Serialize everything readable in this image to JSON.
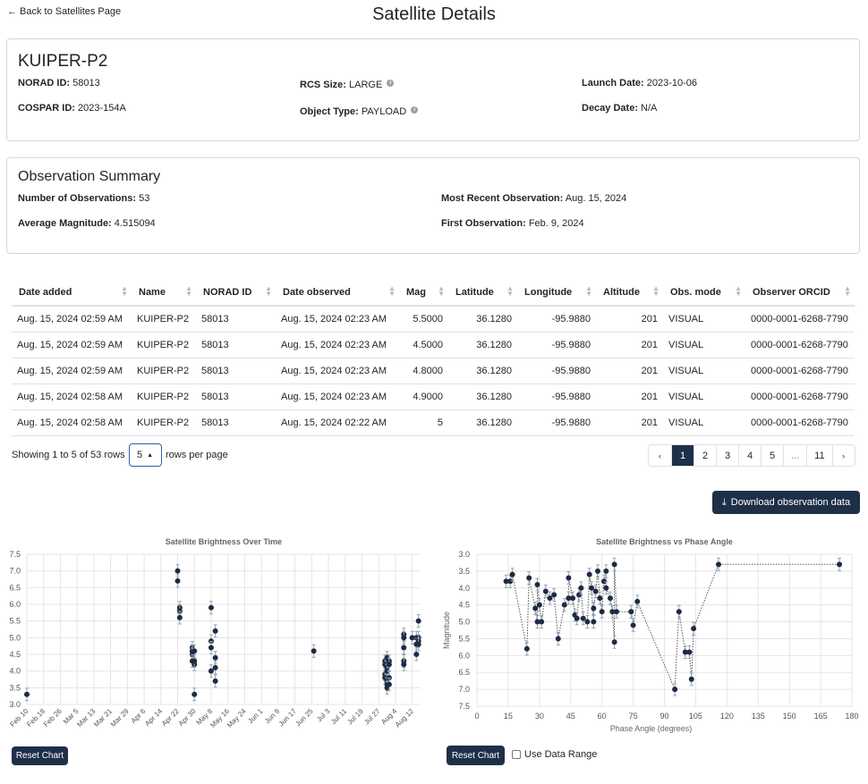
{
  "nav": {
    "back_label": "Back to Satellites Page"
  },
  "page_title": "Satellite Details",
  "satellite": {
    "name": "KUIPER-P2",
    "fields": [
      {
        "label": "NORAD ID:",
        "value": "58013"
      },
      {
        "label": "COSPAR ID:",
        "value": "2023-154A"
      },
      {
        "label": "RCS Size:",
        "value": "LARGE"
      },
      {
        "label": "Object Type:",
        "value": "PAYLOAD"
      },
      {
        "label": "Launch Date:",
        "value": "2023-10-06"
      },
      {
        "label": "Decay Date:",
        "value": "N/A"
      }
    ]
  },
  "summary": {
    "title": "Observation Summary",
    "fields": [
      {
        "label": "Number of Observations:",
        "value": "53"
      },
      {
        "label": "Average Magnitude:",
        "value": "4.515094"
      },
      {
        "label": "Most Recent Observation:",
        "value": "Aug. 15, 2024"
      },
      {
        "label": "First Observation:",
        "value": "Feb. 9, 2024"
      }
    ]
  },
  "table": {
    "columns": [
      "Date added",
      "Name",
      "NORAD ID",
      "Date observed",
      "Mag",
      "Latitude",
      "Longitude",
      "Altitude",
      "Obs. mode",
      "Observer ORCID"
    ],
    "rows": [
      [
        "Aug. 15, 2024 02:59 AM",
        "KUIPER-P2",
        "58013",
        "Aug. 15, 2024 02:23 AM",
        "5.5000",
        "36.1280",
        "-95.9880",
        "201",
        "VISUAL",
        "0000-0001-6268-7790"
      ],
      [
        "Aug. 15, 2024 02:59 AM",
        "KUIPER-P2",
        "58013",
        "Aug. 15, 2024 02:23 AM",
        "4.5000",
        "36.1280",
        "-95.9880",
        "201",
        "VISUAL",
        "0000-0001-6268-7790"
      ],
      [
        "Aug. 15, 2024 02:59 AM",
        "KUIPER-P2",
        "58013",
        "Aug. 15, 2024 02:23 AM",
        "4.8000",
        "36.1280",
        "-95.9880",
        "201",
        "VISUAL",
        "0000-0001-6268-7790"
      ],
      [
        "Aug. 15, 2024 02:58 AM",
        "KUIPER-P2",
        "58013",
        "Aug. 15, 2024 02:23 AM",
        "4.9000",
        "36.1280",
        "-95.9880",
        "201",
        "VISUAL",
        "0000-0001-6268-7790"
      ],
      [
        "Aug. 15, 2024 02:58 AM",
        "KUIPER-P2",
        "58013",
        "Aug. 15, 2024 02:22 AM",
        "5",
        "36.1280",
        "-95.9880",
        "201",
        "VISUAL",
        "0000-0001-6268-7790"
      ]
    ]
  },
  "pager": {
    "showing": "Showing 1 to 5 of 53 rows",
    "rows_per_page_value": "5",
    "rows_per_page_label": "rows per page",
    "prev": "‹",
    "next": "›",
    "pages": [
      "1",
      "2",
      "3",
      "4",
      "5",
      "...",
      "11"
    ],
    "active_page": "1"
  },
  "buttons": {
    "download": "Download observation data",
    "reset_chart": "Reset Chart",
    "use_data_range": "Use Data Range"
  },
  "icons": {
    "back": "arrow-left-icon",
    "info": "info-circle-icon",
    "sort": "sort-icon",
    "download": "download-icon",
    "caret": "caret-up-icon"
  },
  "colors": {
    "accent": "#1e2f48",
    "point": "#1c2b45",
    "grid": "#e5e5e5",
    "select_border": "#2c5ea8"
  },
  "chart_data": [
    {
      "type": "scatter",
      "title": "Satellite Brightness Over Time",
      "xlabel": "",
      "ylabel": "",
      "x_tick_labels": [
        "Feb 10",
        "Feb 18",
        "Feb 26",
        "Mar 5",
        "Mar 13",
        "Mar 21",
        "Mar 29",
        "Apr 6",
        "Apr 14",
        "Apr 22",
        "Apr 30",
        "May 8",
        "May 16",
        "May 24",
        "Jun 1",
        "Jun 9",
        "Jun 17",
        "Jun 25",
        "Jul 3",
        "Jul 11",
        "Jul 19",
        "Jul 27",
        "Aug 4",
        "Aug 12"
      ],
      "y_tick_labels": [
        "3.0",
        "3.5",
        "4.0",
        "4.5",
        "5.0",
        "5.5",
        "6.0",
        "6.5",
        "7.0",
        "7.5"
      ],
      "ylim": [
        3.0,
        7.5
      ],
      "xlim": [
        "2024-02-10",
        "2024-08-16"
      ],
      "grid": true,
      "points": [
        {
          "x": "2024-02-10",
          "y": 3.3
        },
        {
          "x": "2024-04-22",
          "y": 7.0
        },
        {
          "x": "2024-04-22",
          "y": 6.7
        },
        {
          "x": "2024-04-23",
          "y": 5.9
        },
        {
          "x": "2024-04-23",
          "y": 5.8
        },
        {
          "x": "2024-04-23",
          "y": 5.6
        },
        {
          "x": "2024-04-29",
          "y": 4.7
        },
        {
          "x": "2024-04-29",
          "y": 4.6
        },
        {
          "x": "2024-04-29",
          "y": 4.5
        },
        {
          "x": "2024-04-29",
          "y": 4.3
        },
        {
          "x": "2024-04-30",
          "y": 4.2
        },
        {
          "x": "2024-04-30",
          "y": 4.3
        },
        {
          "x": "2024-04-30",
          "y": 4.6
        },
        {
          "x": "2024-04-30",
          "y": 3.3
        },
        {
          "x": "2024-05-08",
          "y": 5.9
        },
        {
          "x": "2024-05-08",
          "y": 4.9
        },
        {
          "x": "2024-05-08",
          "y": 4.7
        },
        {
          "x": "2024-05-08",
          "y": 4.0
        },
        {
          "x": "2024-05-10",
          "y": 5.2
        },
        {
          "x": "2024-05-10",
          "y": 4.4
        },
        {
          "x": "2024-05-10",
          "y": 4.1
        },
        {
          "x": "2024-05-10",
          "y": 3.7
        },
        {
          "x": "2024-06-26",
          "y": 4.6
        },
        {
          "x": "2024-07-30",
          "y": 4.3
        },
        {
          "x": "2024-07-30",
          "y": 4.2
        },
        {
          "x": "2024-07-30",
          "y": 3.9
        },
        {
          "x": "2024-07-30",
          "y": 3.8
        },
        {
          "x": "2024-07-31",
          "y": 4.4
        },
        {
          "x": "2024-07-31",
          "y": 4.1
        },
        {
          "x": "2024-07-31",
          "y": 4.0
        },
        {
          "x": "2024-07-31",
          "y": 3.7
        },
        {
          "x": "2024-07-31",
          "y": 3.6
        },
        {
          "x": "2024-07-31",
          "y": 3.5
        },
        {
          "x": "2024-08-01",
          "y": 4.3
        },
        {
          "x": "2024-08-01",
          "y": 4.2
        },
        {
          "x": "2024-08-01",
          "y": 3.8
        },
        {
          "x": "2024-08-01",
          "y": 3.6
        },
        {
          "x": "2024-08-08",
          "y": 5.1
        },
        {
          "x": "2024-08-08",
          "y": 5.0
        },
        {
          "x": "2024-08-08",
          "y": 4.7
        },
        {
          "x": "2024-08-08",
          "y": 4.3
        },
        {
          "x": "2024-08-08",
          "y": 4.2
        },
        {
          "x": "2024-08-12",
          "y": 5.0
        },
        {
          "x": "2024-08-14",
          "y": 5.0
        },
        {
          "x": "2024-08-14",
          "y": 4.8
        },
        {
          "x": "2024-08-14",
          "y": 4.5
        },
        {
          "x": "2024-08-15",
          "y": 5.5
        },
        {
          "x": "2024-08-15",
          "y": 5.0
        },
        {
          "x": "2024-08-15",
          "y": 4.9
        },
        {
          "x": "2024-08-15",
          "y": 4.8
        }
      ]
    },
    {
      "type": "line",
      "title": "Satellite Brightness vs Phase Angle",
      "xlabel": "Phase Angle (degrees)",
      "ylabel": "Magnitude",
      "xlim": [
        0,
        180
      ],
      "ylim": [
        3.0,
        7.5
      ],
      "y_inverted": true,
      "x_tick_labels": [
        "0",
        "15",
        "30",
        "45",
        "60",
        "75",
        "90",
        "105",
        "120",
        "135",
        "150",
        "165",
        "180"
      ],
      "y_tick_labels": [
        "3.0",
        "3.5",
        "4.0",
        "4.5",
        "5.0",
        "5.5",
        "6.0",
        "6.5",
        "7.0",
        "7.5"
      ],
      "grid": true,
      "line_style": "dotted",
      "points": [
        {
          "x": 14,
          "y": 3.8
        },
        {
          "x": 16,
          "y": 3.8
        },
        {
          "x": 17,
          "y": 3.6
        },
        {
          "x": 24,
          "y": 5.8
        },
        {
          "x": 25,
          "y": 3.7
        },
        {
          "x": 28,
          "y": 4.6
        },
        {
          "x": 29,
          "y": 5.0
        },
        {
          "x": 29,
          "y": 3.9
        },
        {
          "x": 30,
          "y": 4.5
        },
        {
          "x": 31,
          "y": 5.0
        },
        {
          "x": 33,
          "y": 4.1
        },
        {
          "x": 35,
          "y": 4.3
        },
        {
          "x": 37,
          "y": 4.2
        },
        {
          "x": 39,
          "y": 5.5
        },
        {
          "x": 42,
          "y": 4.5
        },
        {
          "x": 44,
          "y": 4.3
        },
        {
          "x": 44,
          "y": 3.7
        },
        {
          "x": 46,
          "y": 4.3
        },
        {
          "x": 47,
          "y": 4.8
        },
        {
          "x": 48,
          "y": 4.9
        },
        {
          "x": 49,
          "y": 4.2
        },
        {
          "x": 50,
          "y": 4.0
        },
        {
          "x": 51,
          "y": 4.9
        },
        {
          "x": 53,
          "y": 5.0
        },
        {
          "x": 54,
          "y": 3.6
        },
        {
          "x": 55,
          "y": 4.0
        },
        {
          "x": 56,
          "y": 5.0
        },
        {
          "x": 56,
          "y": 4.6
        },
        {
          "x": 57,
          "y": 4.1
        },
        {
          "x": 58,
          "y": 3.5
        },
        {
          "x": 59,
          "y": 4.3
        },
        {
          "x": 60,
          "y": 4.7
        },
        {
          "x": 61,
          "y": 3.8
        },
        {
          "x": 62,
          "y": 3.5
        },
        {
          "x": 62,
          "y": 4.0
        },
        {
          "x": 64,
          "y": 4.3
        },
        {
          "x": 65,
          "y": 4.7
        },
        {
          "x": 66,
          "y": 5.6
        },
        {
          "x": 66,
          "y": 3.3
        },
        {
          "x": 67,
          "y": 4.7
        },
        {
          "x": 74,
          "y": 4.7
        },
        {
          "x": 75,
          "y": 5.1
        },
        {
          "x": 77,
          "y": 4.4
        },
        {
          "x": 95,
          "y": 7.0
        },
        {
          "x": 97,
          "y": 4.7
        },
        {
          "x": 100,
          "y": 5.9
        },
        {
          "x": 102,
          "y": 5.9
        },
        {
          "x": 103,
          "y": 6.7
        },
        {
          "x": 104,
          "y": 5.2
        },
        {
          "x": 116,
          "y": 3.3
        },
        {
          "x": 174,
          "y": 3.3
        }
      ]
    }
  ]
}
